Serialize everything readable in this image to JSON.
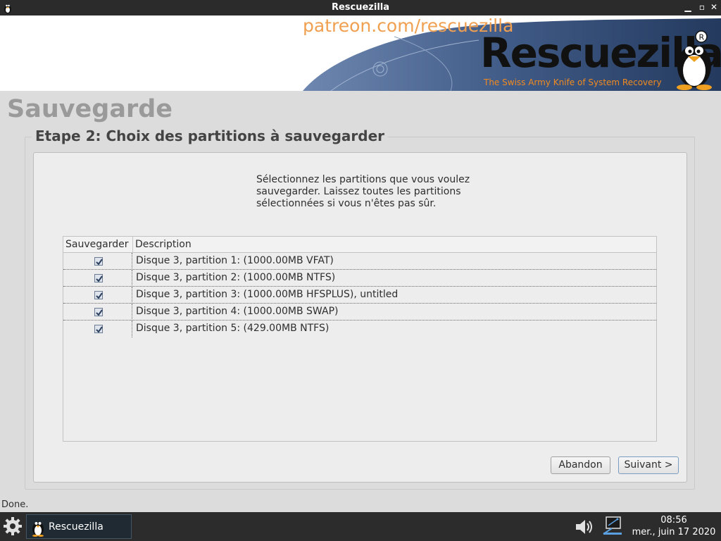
{
  "window": {
    "title": "Rescuezilla"
  },
  "banner": {
    "patreon": "patreon.com/rescuezilla",
    "logo": "Rescuezilla",
    "tagline": "The Swiss Army Knife of System Recovery"
  },
  "page": {
    "title": "Sauvegarde",
    "step_title": "Etape 2: Choix des partitions à sauvegarder",
    "instructions": "Sélectionnez les partitions que vous voulez sauvegarder. Laissez toutes les partitions sélectionnées si vous n'êtes pas sûr."
  },
  "table": {
    "columns": [
      "Sauvegarder",
      "Description"
    ],
    "rows": [
      {
        "checked": true,
        "description": "Disque 3, partition 1: (1000.00MB VFAT)"
      },
      {
        "checked": true,
        "description": "Disque 3, partition 2: (1000.00MB NTFS)"
      },
      {
        "checked": true,
        "description": "Disque 3, partition 3: (1000.00MB HFSPLUS), untitled"
      },
      {
        "checked": true,
        "description": "Disque 3, partition 4: (1000.00MB SWAP)"
      },
      {
        "checked": true,
        "description": "Disque 3, partition 5: (429.00MB NTFS)"
      }
    ]
  },
  "buttons": {
    "abandon": "Abandon",
    "next": "Suivant >"
  },
  "status": "Done.",
  "taskbar": {
    "task_label": "Rescuezilla",
    "time": "08:56",
    "date": "mer., juin 17 2020"
  },
  "colors": {
    "patreon": "#f0a050",
    "tagline": "#f08a20",
    "titlebar": "#2b2b2b",
    "taskbar": "#2c2c2c"
  }
}
